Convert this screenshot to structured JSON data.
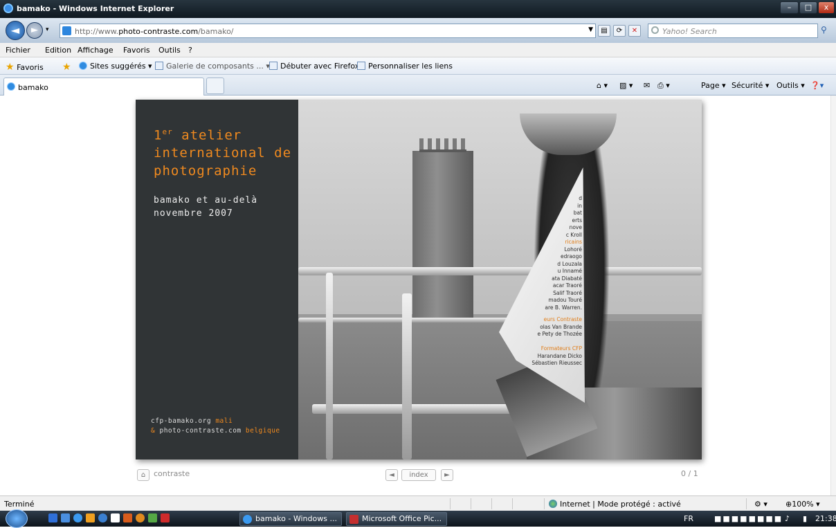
{
  "window": {
    "title": "bamako - Windows Internet Explorer",
    "minimize": "–",
    "maximize": "□",
    "close": "x"
  },
  "address": {
    "url_prefix": "http://www.",
    "url_domain": "photo-contraste.com",
    "url_path": "/bamako/",
    "search_placeholder": "Yahoo! Search"
  },
  "menu": [
    "Fichier",
    "Edition",
    "Affichage",
    "Favoris",
    "Outils",
    "?"
  ],
  "favorites": {
    "label": "Favoris",
    "items": [
      "Sites suggérés ▾",
      "Galerie de composants ... ▾",
      "Débuter avec Firefox",
      "Personnaliser les liens"
    ]
  },
  "tab": {
    "label": "bamako"
  },
  "command_bar": [
    "Page ▾",
    "Sécurité ▾",
    "Outils ▾"
  ],
  "page": {
    "heading": "1er atelier international de photographie",
    "heading_line1": "atelier",
    "heading_super": "er",
    "heading_number": "1",
    "heading_line2": "international de",
    "heading_line3": "photographie",
    "subtitle_line1": "bamako et au-delà",
    "subtitle_line2": "novembre 2007",
    "footer_line1": "cfp-bamako.org",
    "footer_line1_accent": "mali",
    "footer_line2_prefix": "&",
    "footer_line2": "photo-contraste.com",
    "footer_line2_accent": "belgique",
    "credits_top": [
      "d",
      "in",
      "bat",
      "erts",
      "nove",
      "c Kroll"
    ],
    "credits_africains": [
      "Lohoré",
      "edraogo",
      "d Louzala",
      "u Innamé",
      "ata Diabaté",
      "acar Traoré",
      "Salif Traoré",
      "madou Touré",
      "are B. Warren."
    ],
    "credits_contraste_title": "eurs Contraste",
    "credits_contraste": [
      "olas Van Brande",
      "e Pety de Thozée"
    ],
    "credits_cfp_title": "Formateurs CFP",
    "credits_cfp": [
      "Harandane Dicko",
      "Sébastien Rieussec"
    ],
    "africains_title": "ricains",
    "nav": {
      "home_label": "contraste",
      "index_label": "index",
      "page_counter": "0 / 1"
    }
  },
  "status": {
    "left": "Terminé",
    "zone": "Internet | Mode protégé : activé",
    "zoom": "100%"
  },
  "taskbar": {
    "tasks": [
      "bamako - Windows ...",
      "Microsoft Office Pic..."
    ],
    "lang": "FR",
    "time": "21:38"
  }
}
